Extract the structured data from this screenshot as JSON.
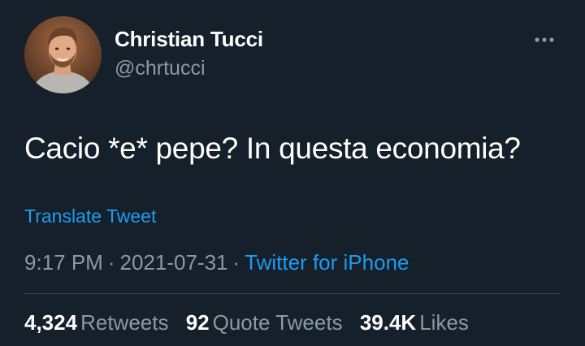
{
  "author": {
    "name": "Christian Tucci",
    "handle": "@chrtucci"
  },
  "icons": {
    "avatar": "profile-photo",
    "more": "more-options-icon"
  },
  "tweet": {
    "text": "Cacio *e* pepe? In questa economia?",
    "translate_label": "Translate Tweet",
    "time": "9:17 PM",
    "separator": "·",
    "date": "2021-07-31",
    "source": "Twitter for iPhone"
  },
  "stats": {
    "retweets_count": "4,324",
    "retweets_label": "Retweets",
    "quotes_count": "92",
    "quotes_label": "Quote Tweets",
    "likes_count": "39.4K",
    "likes_label": "Likes"
  },
  "colors": {
    "background": "#15202b",
    "link": "#1d9bf0",
    "secondary_text": "#8b98a5",
    "divider": "#38444d"
  }
}
